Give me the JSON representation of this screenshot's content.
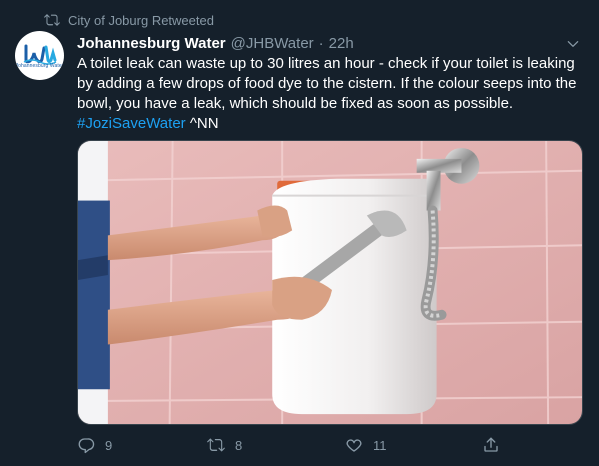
{
  "retweet_context": {
    "label": "City of Joburg Retweeted",
    "icon": "retweet-icon"
  },
  "author": {
    "name": "Johannesburg Water",
    "handle": "@JHBWater",
    "separator": "·",
    "time": "22h",
    "avatar_text": "Johannesburg Water"
  },
  "tweet": {
    "text_part1": "A toilet leak can waste up to 30 litres an hour - check if your toilet is leaking by adding a few drops of food dye to the cistern. If the colour seeps into the bowl, you have a leak, which should be fixed as soon as possible.",
    "hashtag": "#JoziSaveWater",
    "text_part2": "^NN"
  },
  "actions": {
    "reply_count": "9",
    "retweet_count": "8",
    "like_count": "11"
  },
  "colors": {
    "background": "#15202b",
    "secondary_text": "#8899a6",
    "link": "#1da1f2",
    "tile": "#e8b7b5"
  }
}
